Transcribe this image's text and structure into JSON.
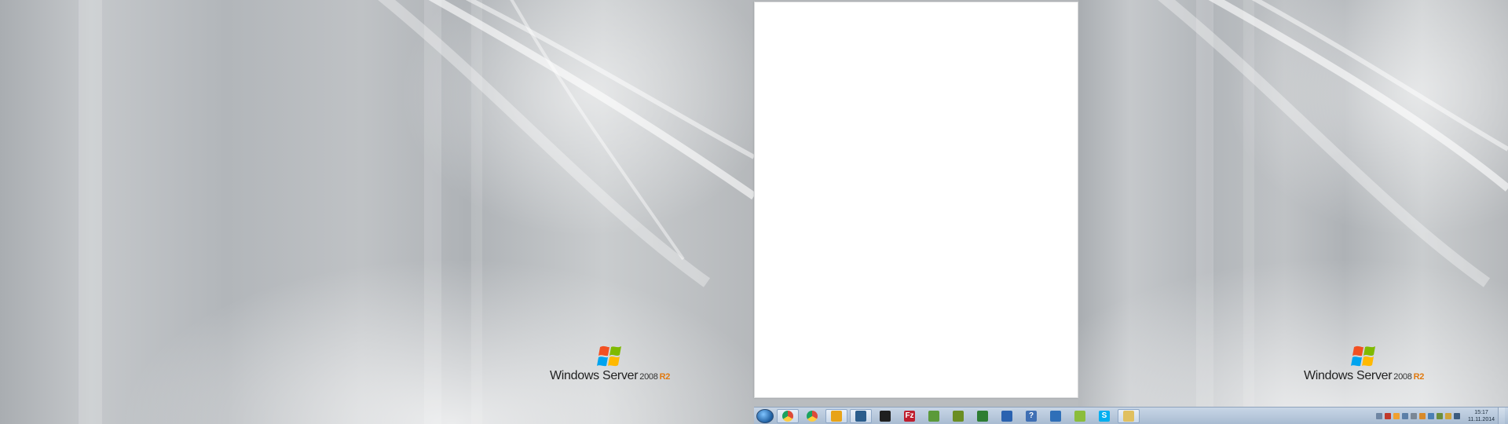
{
  "desktop": {
    "branding": {
      "product": "Windows Server",
      "version": "2008",
      "release": "R2"
    }
  },
  "taskbar": {
    "pinned": [
      {
        "icon": "start-orb",
        "color": "#1d5c9e"
      },
      {
        "icon": "chrome-icon",
        "color": "#dd4b39",
        "active": true
      },
      {
        "icon": "chrome-icon",
        "color": "#dd4b39",
        "active": false
      },
      {
        "icon": "outlook-icon",
        "color": "#e8a317",
        "active": true
      },
      {
        "icon": "remote-desktop-icon",
        "color": "#2b5d8c",
        "active": true
      },
      {
        "icon": "terminal-icon",
        "color": "#1f1f1f",
        "active": false
      },
      {
        "icon": "filezilla-icon",
        "color": "#bf1e2e",
        "active": false,
        "glyph": "Fz"
      },
      {
        "icon": "network-icon",
        "color": "#5b9a3a",
        "active": false
      },
      {
        "icon": "notepad-icon",
        "color": "#6b8e23",
        "active": false
      },
      {
        "icon": "spreadsheet-icon",
        "color": "#2e7d32",
        "active": false
      },
      {
        "icon": "globe-icon",
        "color": "#2a62b0",
        "active": false
      },
      {
        "icon": "help-icon",
        "color": "#3f6fb4",
        "active": false,
        "glyph": "?"
      },
      {
        "icon": "users-icon",
        "color": "#2f6fb8",
        "active": false
      },
      {
        "icon": "check-icon",
        "color": "#8bbd3c",
        "active": false
      },
      {
        "icon": "skype-icon",
        "color": "#00aff0",
        "active": false,
        "glyph": "S"
      },
      {
        "icon": "folder-icon",
        "color": "#e0c060",
        "active": true
      }
    ],
    "tray_icons": [
      "keyboard-icon",
      "alert-icon",
      "camera-icon",
      "window-icon",
      "printer-icon",
      "battery-icon",
      "network-tray-icon",
      "shield-tray-icon",
      "flag-tray-icon",
      "volume-icon"
    ],
    "tray_colors": [
      "#6f86a3",
      "#c0392b",
      "#f0a030",
      "#5b7fa8",
      "#7a8796",
      "#d88a2a",
      "#4a7fb4",
      "#6c8e3b",
      "#cfa33a",
      "#3b5b7e"
    ],
    "clock": {
      "time": "15:17",
      "date": "11.11.2014"
    }
  }
}
